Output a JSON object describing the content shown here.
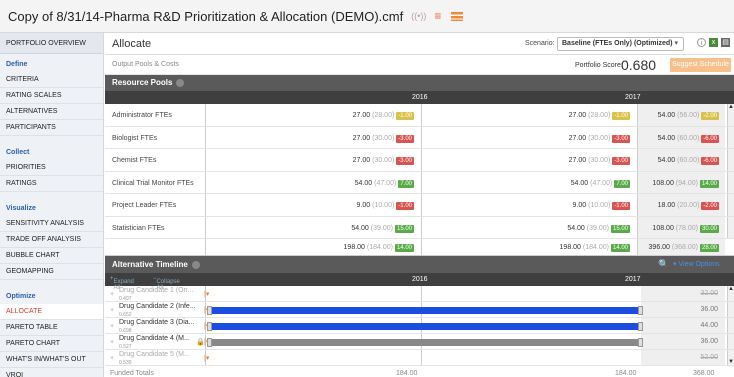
{
  "window": {
    "title": "Copy of 8/31/14-Pharma R&D Prioritization & Allocation (DEMO).cmf"
  },
  "sidebar": {
    "top": "PORTFOLIO OVERVIEW",
    "groups": [
      {
        "heading": "Define",
        "items": [
          "CRITERIA",
          "RATING SCALES",
          "ALTERNATIVES",
          "PARTICIPANTS"
        ]
      },
      {
        "heading": "Collect",
        "items": [
          "PRIORITIES",
          "RATINGS"
        ]
      },
      {
        "heading": "Visualize",
        "items": [
          "SENSITIVITY ANALYSIS",
          "TRADE OFF ANALYSIS",
          "BUBBLE CHART",
          "GEOMAPPING"
        ]
      },
      {
        "heading": "Optimize",
        "items": [
          "ALLOCATE",
          "PARETO TABLE",
          "PARETO CHART",
          "WHAT'S IN/WHAT'S OUT",
          "VROI"
        ]
      }
    ],
    "active": "ALLOCATE"
  },
  "header": {
    "title": "Allocate",
    "scenario_label": "Scenario:",
    "scenario_value": "Baseline (FTEs Only) (Optimized)",
    "subtitle": "Output Pools & Costs",
    "score_label": "Portfolio Score:",
    "score_value": "0.680",
    "suggest_label": "Suggest Schedule"
  },
  "resource_pools": {
    "title": "Resource Pools",
    "years": [
      "2016",
      "2017"
    ],
    "rows": [
      {
        "name": "Administrator FTEs",
        "y2016": "27.00",
        "y2016_g": "(28.00)",
        "y2016_b": "-1.00",
        "y2016_c": "y",
        "y2017": "27.00",
        "y2017_g": "(28.00)",
        "y2017_b": "-1.00",
        "y2017_c": "y",
        "tot": "54.00",
        "tot_g": "(56.00)",
        "tot_b": "-2.00",
        "tot_c": "y"
      },
      {
        "name": "Biologist FTEs",
        "y2016": "27.00",
        "y2016_g": "(30.00)",
        "y2016_b": "-3.00",
        "y2016_c": "r",
        "y2017": "27.00",
        "y2017_g": "(30.00)",
        "y2017_b": "-3.00",
        "y2017_c": "r",
        "tot": "54.00",
        "tot_g": "(60.00)",
        "tot_b": "-6.00",
        "tot_c": "r"
      },
      {
        "name": "Chemist FTEs",
        "y2016": "27.00",
        "y2016_g": "(30.00)",
        "y2016_b": "-3.00",
        "y2016_c": "r",
        "y2017": "27.00",
        "y2017_g": "(30.00)",
        "y2017_b": "-3.00",
        "y2017_c": "r",
        "tot": "54.00",
        "tot_g": "(60.00)",
        "tot_b": "-6.00",
        "tot_c": "r"
      },
      {
        "name": "Clinical Trial Monitor FTEs",
        "y2016": "54.00",
        "y2016_g": "(47.00)",
        "y2016_b": "7.00",
        "y2016_c": "g",
        "y2017": "54.00",
        "y2017_g": "(47.00)",
        "y2017_b": "7.00",
        "y2017_c": "g",
        "tot": "108.00",
        "tot_g": "(94.00)",
        "tot_b": "14.00",
        "tot_c": "g"
      },
      {
        "name": "Project Leader FTEs",
        "y2016": "9.00",
        "y2016_g": "(10.00)",
        "y2016_b": "-1.00",
        "y2016_c": "r",
        "y2017": "9.00",
        "y2017_g": "(10.00)",
        "y2017_b": "-1.00",
        "y2017_c": "r",
        "tot": "18.00",
        "tot_g": "(20.00)",
        "tot_b": "-2.00",
        "tot_c": "r"
      },
      {
        "name": "Statistician FTEs",
        "y2016": "54.00",
        "y2016_g": "(39.00)",
        "y2016_b": "15.00",
        "y2016_c": "g",
        "y2017": "54.00",
        "y2017_g": "(39.00)",
        "y2017_b": "15.00",
        "y2017_c": "g",
        "tot": "108.00",
        "tot_g": "(78.00)",
        "tot_b": "30.00",
        "tot_c": "g"
      }
    ],
    "total": {
      "y2016": "198.00",
      "y2016_g": "(184.00)",
      "y2016_b": "14.00",
      "y2017": "198.00",
      "y2017_g": "(184.00)",
      "y2017_b": "14.00",
      "tot": "396.00",
      "tot_g": "(368.00)",
      "tot_b": "28.00"
    }
  },
  "timeline": {
    "title": "Alternative Timeline",
    "expand_label": "Expand All",
    "collapse_label": "Collapse All",
    "view_options": "View Options",
    "years": [
      "2016",
      "2017"
    ],
    "rows": [
      {
        "name": "Drug Candidate 1 (On...",
        "score": "0.497",
        "cost": "32.00",
        "funded": false,
        "bar": "none"
      },
      {
        "name": "Drug Candidate 2 (Infe...",
        "score": "0.652",
        "cost": "36.00",
        "funded": true,
        "bar": "blue"
      },
      {
        "name": "Drug Candidate 3 (Dia...",
        "score": "0.698",
        "cost": "44.00",
        "funded": true,
        "bar": "blue"
      },
      {
        "name": "Drug Candidate 4 (M...",
        "score": "0.527",
        "cost": "36.00",
        "funded": true,
        "bar": "gray",
        "locked": true
      },
      {
        "name": "Drug Candidate 5 (M...",
        "score": "0.539",
        "cost": "52.00",
        "funded": false,
        "bar": "none"
      }
    ],
    "funded_label": "Funded Totals",
    "funded_2016": "184.00",
    "funded_2017": "184.00",
    "funded_total": "368.00"
  }
}
